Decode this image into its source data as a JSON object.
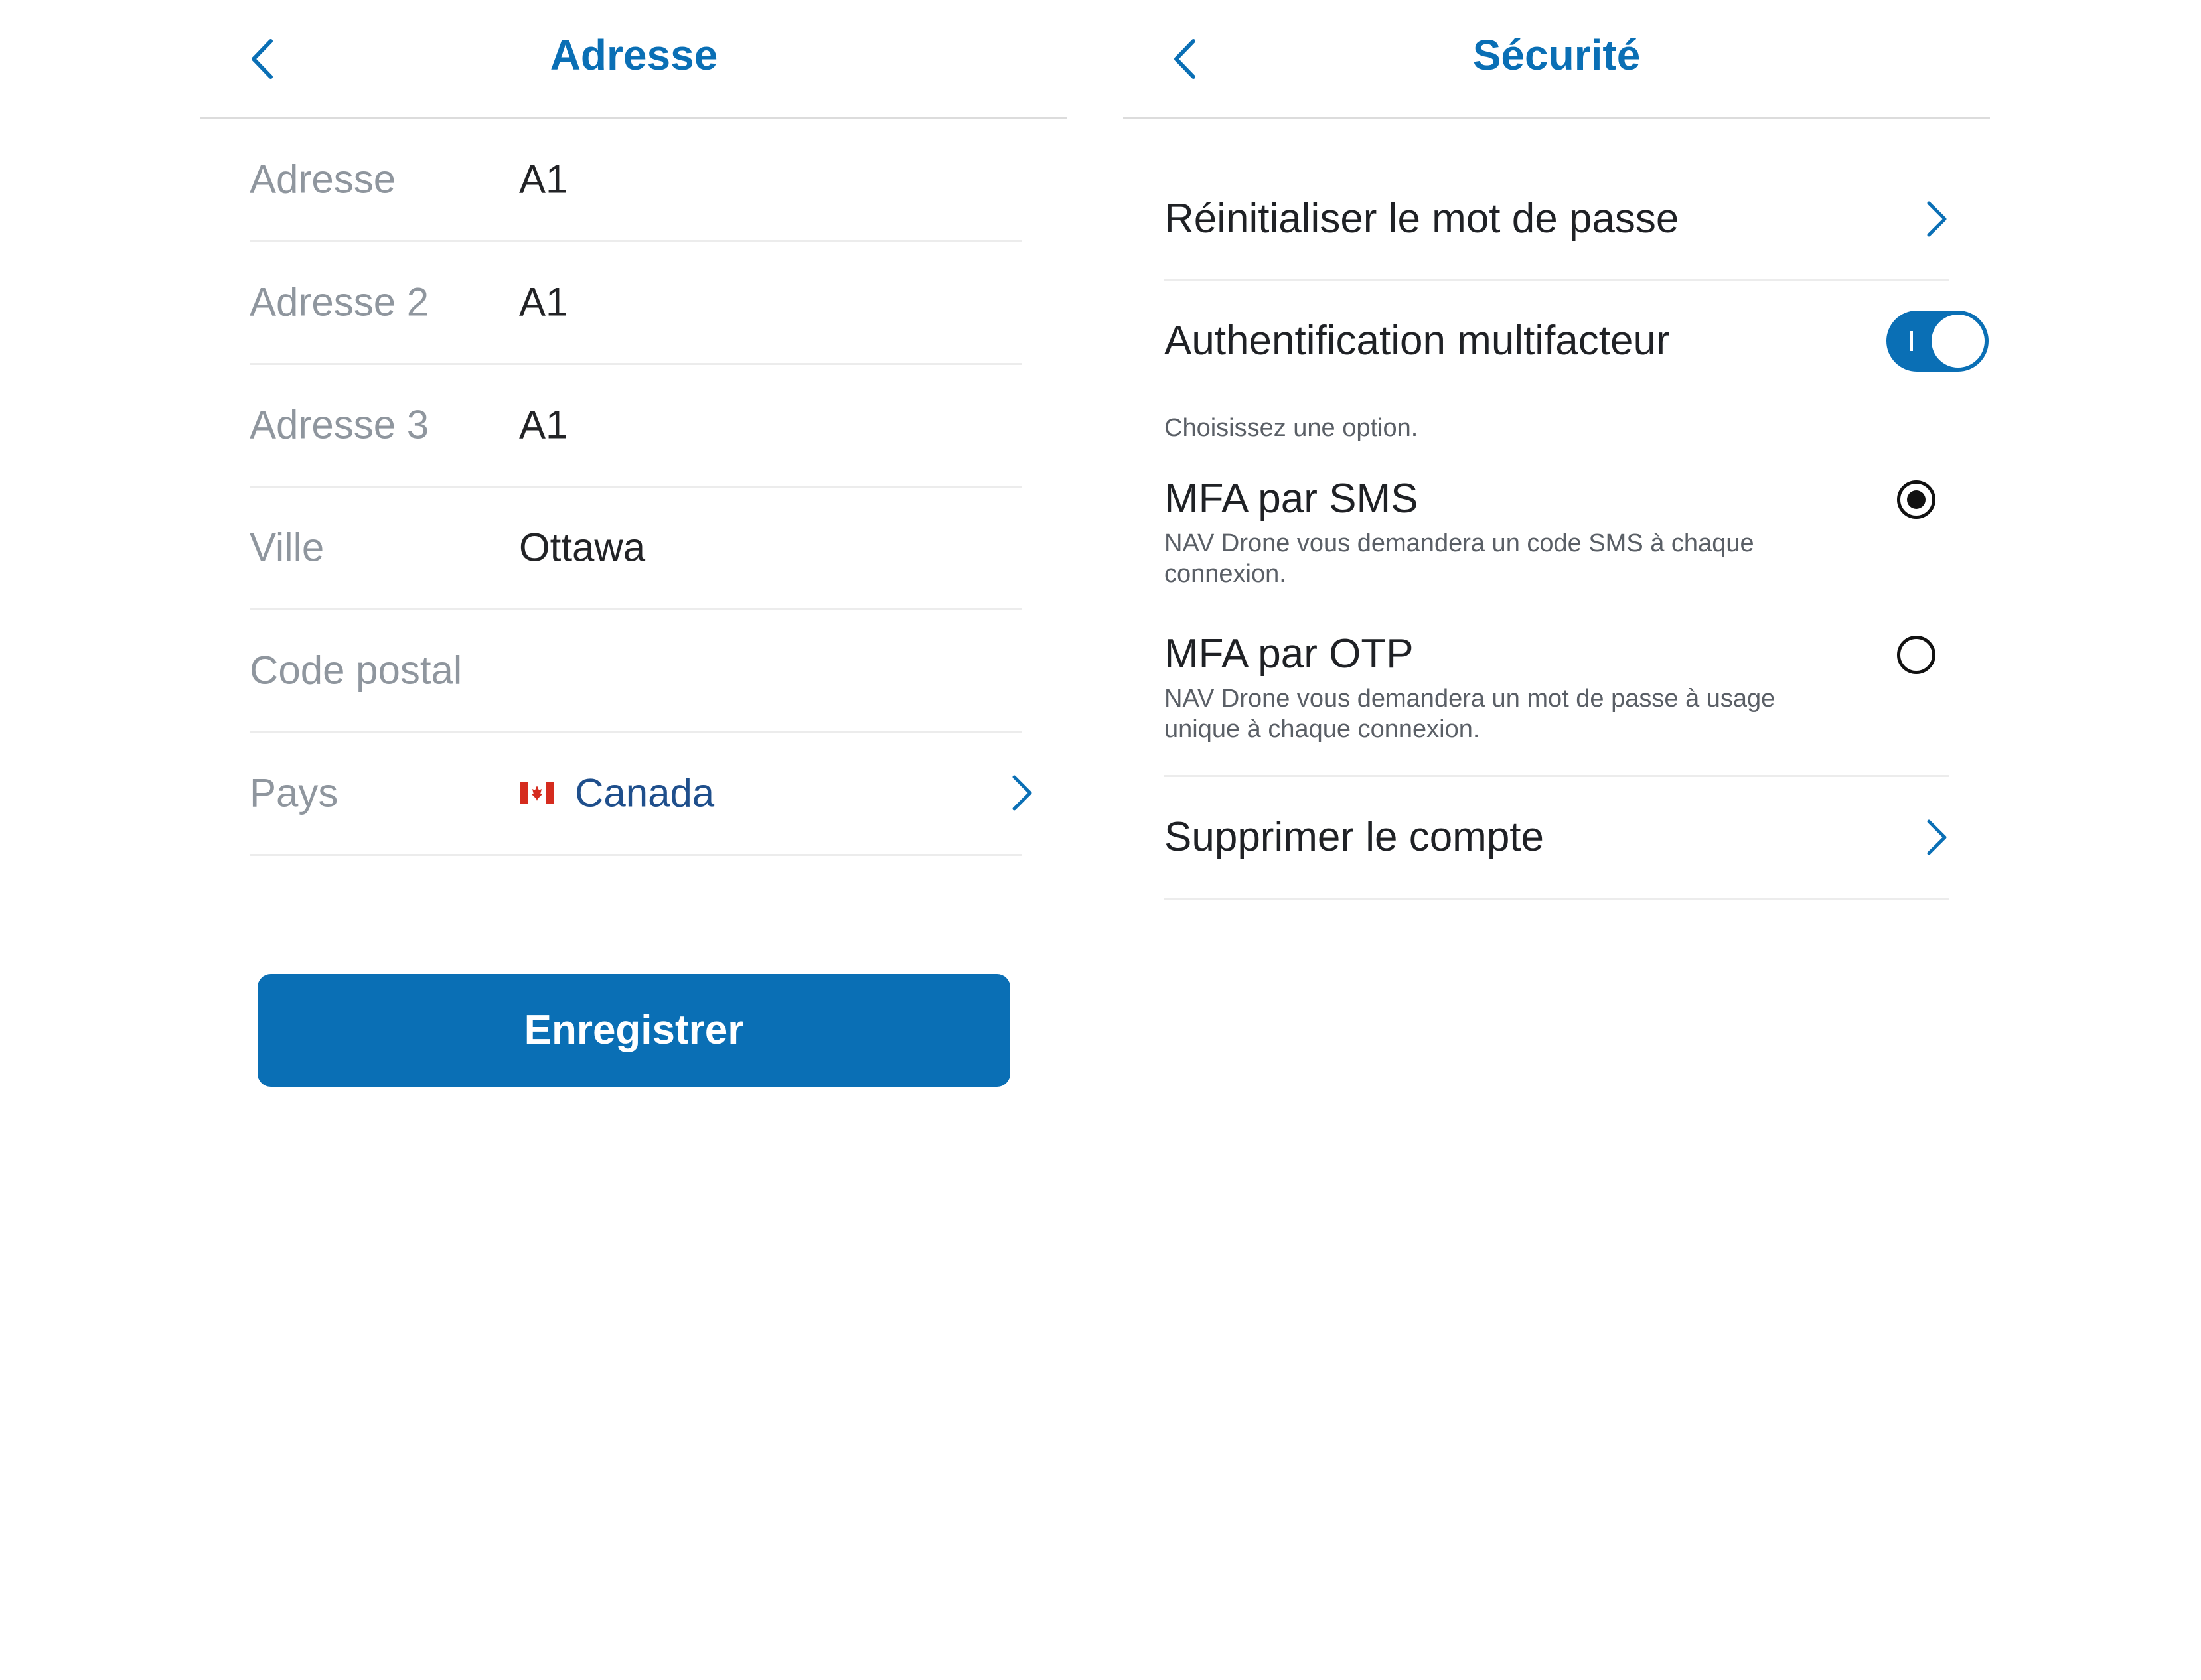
{
  "address_screen": {
    "title": "Adresse",
    "fields": [
      {
        "label": "Adresse",
        "value": "A1"
      },
      {
        "label": "Adresse 2",
        "value": "A1"
      },
      {
        "label": "Adresse 3",
        "value": "A1"
      },
      {
        "label": "Ville",
        "value": "Ottawa"
      },
      {
        "label": "Code postal",
        "value": ""
      }
    ],
    "country": {
      "label": "Pays",
      "value": "Canada",
      "flag_icon": "canada-flag-icon"
    },
    "save_label": "Enregistrer"
  },
  "security_screen": {
    "title": "Sécurité",
    "reset_password_label": "Réinitialiser le mot de passe",
    "mfa_label": "Authentification multifacteur",
    "mfa_enabled": true,
    "choose_hint": "Choisissez une option.",
    "options": [
      {
        "title": "MFA par SMS",
        "description": "NAV Drone vous demandera un code SMS à chaque connexion.",
        "selected": true
      },
      {
        "title": "MFA par OTP",
        "description": "NAV Drone vous demandera un mot de passe à usage unique à chaque connexion.",
        "selected": false
      }
    ],
    "delete_account_label": "Supprimer le compte"
  },
  "colors": {
    "accent": "#0a6fb5",
    "label_gray": "#8f969e",
    "text": "#1f2125",
    "country_text": "#1f4f8c"
  }
}
